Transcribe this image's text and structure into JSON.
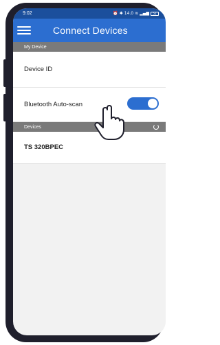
{
  "status_bar": {
    "time": "9:02",
    "net_speed": "14.0",
    "battery": "51"
  },
  "app_bar": {
    "title": "Connect Devices",
    "menu_icon": "hamburger-menu-icon"
  },
  "my_device": {
    "section_label": "My Device",
    "device_id_label": "Device ID",
    "autoscan_label": "Bluetooth Auto-scan",
    "autoscan_enabled": true
  },
  "devices": {
    "section_label": "Devices",
    "items": [
      {
        "name": "TS 320BPEC"
      }
    ]
  },
  "colors": {
    "primary": "#2c6ed0",
    "status_bar": "#1b4f9c",
    "section_header": "#7a7a7a",
    "frame": "#1f1f2c"
  }
}
